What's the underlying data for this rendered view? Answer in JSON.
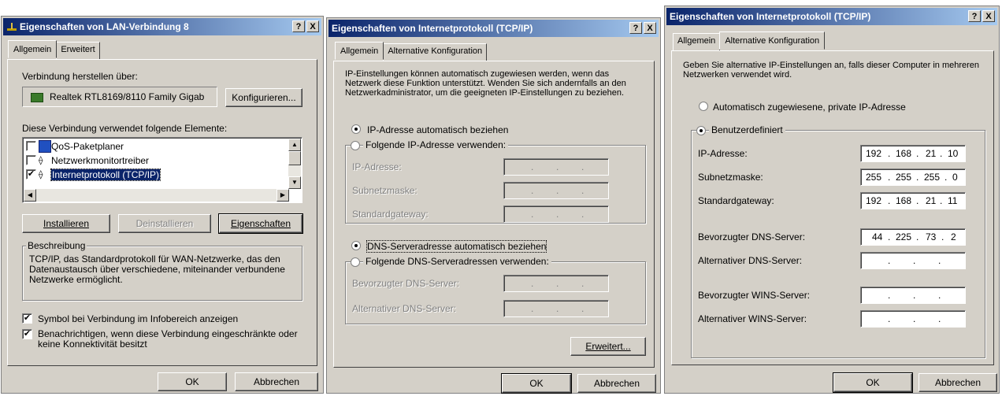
{
  "dialog1": {
    "title": "Eigenschaften von LAN-Verbindung 8",
    "tb_help": "?",
    "tb_close": "X",
    "tabs": [
      "Allgemein",
      "Erweitert"
    ],
    "connect_label": "Verbindung herstellen über:",
    "adapter_name": "Realtek RTL8169/8110 Family Gigab",
    "configure_button": "Konfigurieren...",
    "items_label": "Diese Verbindung verwendet folgende Elemente:",
    "items": [
      {
        "label": "QoS-Paketplaner",
        "checked": false
      },
      {
        "label": "Netzwerkmonitortreiber",
        "checked": false
      },
      {
        "label": "Internetprotokoll (TCP/IP)",
        "checked": true
      }
    ],
    "install_button": "Installieren",
    "uninstall_button": "Deinstallieren",
    "properties_button": "Eigenschaften",
    "description_legend": "Beschreibung",
    "description_text": "TCP/IP, das Standardprotokoll für WAN-Netzwerke, das den Datenaustausch über verschiedene, miteinander verbundene Netzwerke ermöglicht.",
    "show_icon_label": "Symbol bei Verbindung im Infobereich anzeigen",
    "notify_label": "Benachrichtigen, wenn diese Verbindung eingeschränkte oder keine Konnektivität besitzt",
    "ok_button": "OK",
    "cancel_button": "Abbrechen"
  },
  "dialog2": {
    "title": "Eigenschaften von Internetprotokoll (TCP/IP)",
    "tb_help": "?",
    "tb_close": "X",
    "tabs": [
      "Allgemein",
      "Alternative Konfiguration"
    ],
    "intro_text": "IP-Einstellungen können automatisch zugewiesen werden, wenn das Netzwerk diese Funktion unterstützt. Wenden Sie sich andernfalls an den Netzwerkadministrator, um die geeigneten IP-Einstellungen zu beziehen.",
    "auto_ip_label": "IP-Adresse automatisch beziehen",
    "manual_ip_label": "Folgende IP-Adresse verwenden:",
    "ip_label": "IP-Adresse:",
    "subnet_label": "Subnetzmaske:",
    "gateway_label": "Standardgateway:",
    "auto_dns_label": "DNS-Serveradresse automatisch beziehen",
    "manual_dns_label": "Folgende DNS-Serveradressen verwenden:",
    "pref_dns_label": "Bevorzugter DNS-Server:",
    "alt_dns_label": "Alternativer DNS-Server:",
    "dots": ".",
    "advanced_button": "Erweitert...",
    "ok_button": "OK",
    "cancel_button": "Abbrechen"
  },
  "dialog3": {
    "title": "Eigenschaften von Internetprotokoll (TCP/IP)",
    "tb_help": "?",
    "tb_close": "X",
    "tabs": [
      "Allgemein",
      "Alternative Konfiguration"
    ],
    "intro_text": "Geben Sie alternative IP-Einstellungen an, falls dieser Computer in mehreren Netzwerken verwendet wird.",
    "auto_private_label": "Automatisch zugewiesene, private IP-Adresse",
    "custom_label": "Benutzerdefiniert",
    "ip_label": "IP-Adresse:",
    "ip": [
      "192",
      "168",
      "21",
      "10"
    ],
    "subnet_label": "Subnetzmaske:",
    "subnet": [
      "255",
      "255",
      "255",
      "0"
    ],
    "gateway_label": "Standardgateway:",
    "gateway": [
      "192",
      "168",
      "21",
      "11"
    ],
    "pref_dns_label": "Bevorzugter DNS-Server:",
    "pref_dns": [
      "44",
      "225",
      "73",
      "2"
    ],
    "alt_dns_label": "Alternativer DNS-Server:",
    "pref_wins_label": "Bevorzugter WINS-Server:",
    "alt_wins_label": "Alternativer WINS-Server:",
    "dots": ".",
    "ok_button": "OK",
    "cancel_button": "Abbrechen"
  }
}
